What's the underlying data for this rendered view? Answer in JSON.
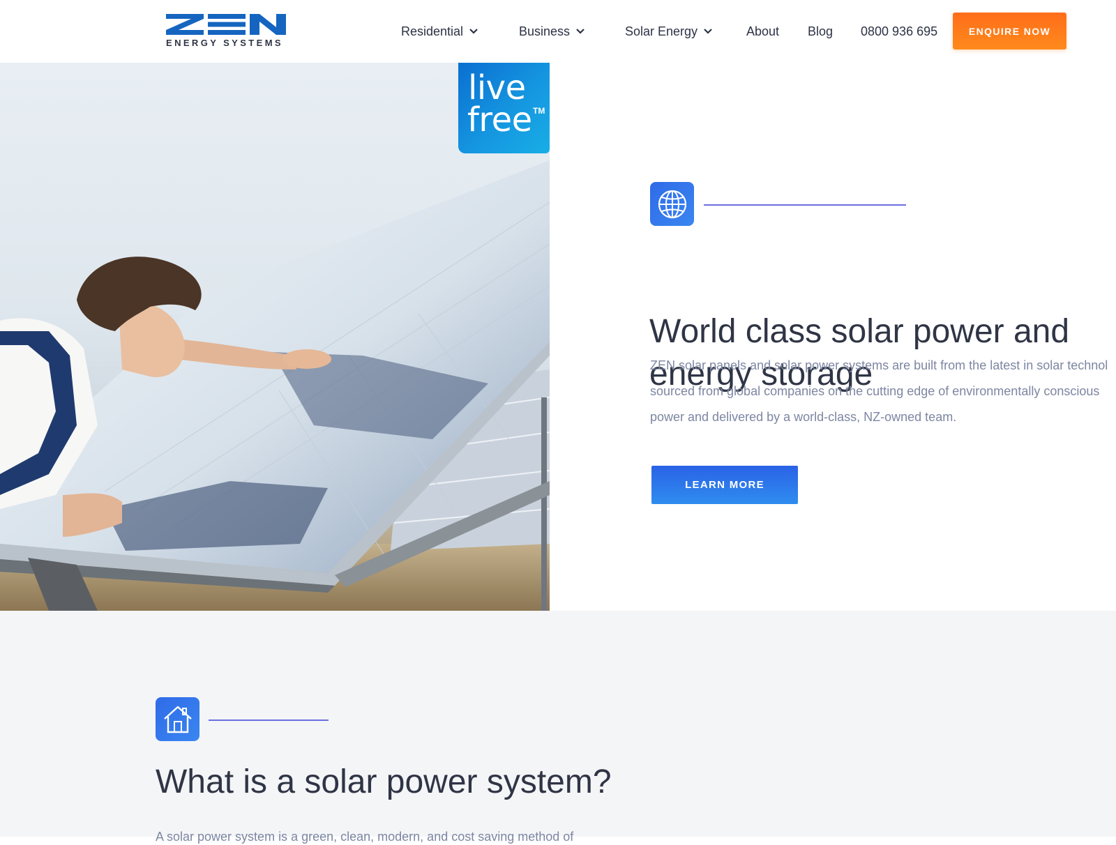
{
  "header": {
    "logo_text": "ZEN",
    "logo_subtitle": "ENERGY SYSTEMS",
    "nav": [
      {
        "label": "Residential",
        "has_dropdown": true
      },
      {
        "label": "Business",
        "has_dropdown": true
      },
      {
        "label": "Solar Energy",
        "has_dropdown": true
      },
      {
        "label": "About",
        "has_dropdown": false
      },
      {
        "label": "Blog",
        "has_dropdown": false
      }
    ],
    "phone": "0800 936 695",
    "cta_label": "ENQUIRE NOW"
  },
  "hero": {
    "badge": {
      "line1": "live",
      "line2": "free",
      "tm": "TM"
    },
    "icon": "globe-icon",
    "title_lines": [
      "World class solar power and",
      "energy storage"
    ],
    "description_lines": [
      "ZEN solar panels and solar power systems are built from the latest in solar technol",
      "sourced from global companies on the cutting edge of environmentally conscious",
      "power and delivered by a world-class, NZ-owned team."
    ],
    "button_label": "LEARN MORE"
  },
  "section2": {
    "icon": "home-icon",
    "title": "What is a solar power system?",
    "text": "A solar power system is a green, clean, modern, and cost saving method of"
  },
  "colors": {
    "brand_blue": "#1565c0",
    "accent_orange": "#ff7a1a",
    "button_blue": "#2a6ce8",
    "accent_line": "#6b6fe0",
    "body_text": "#7d86a2",
    "heading_text": "#2f3545"
  }
}
